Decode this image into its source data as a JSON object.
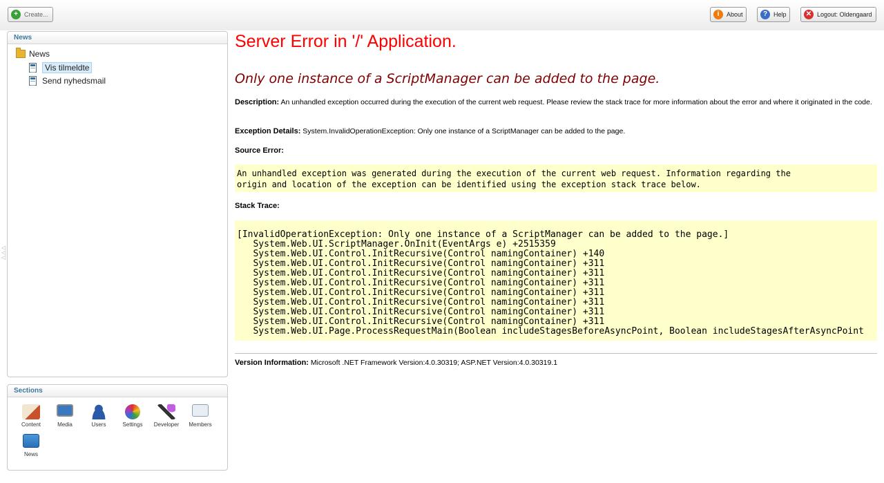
{
  "toolbar": {
    "create_label": "Create...",
    "about_label": "About",
    "help_label": "Help",
    "logout_label": "Logout: Oldengaard"
  },
  "tree_panel": {
    "title": "News",
    "root": "News",
    "items": [
      "Vis tilmeldte",
      "Send nyhedsmail"
    ],
    "selected_index": 0
  },
  "sections_panel": {
    "title": "Sections",
    "items": [
      {
        "label": "Content",
        "icon": "content-icon",
        "color": "#c8502a"
      },
      {
        "label": "Media",
        "icon": "media-icon",
        "color": "#3a78c0"
      },
      {
        "label": "Users",
        "icon": "users-icon",
        "color": "#2a5aa8"
      },
      {
        "label": "Settings",
        "icon": "settings-icon",
        "color": "#e0a020"
      },
      {
        "label": "Developer",
        "icon": "developer-icon",
        "color": "#7a3a9a"
      },
      {
        "label": "Members",
        "icon": "members-icon",
        "color": "#5a7aa0"
      },
      {
        "label": "News",
        "icon": "news-icon",
        "color": "#4a98d8"
      }
    ]
  },
  "error_page": {
    "title": "Server Error in '/' Application.",
    "message": "Only one instance of a ScriptManager can be added to the page.",
    "description_label": "Description:",
    "description_text": "An unhandled exception occurred during the execution of the current web request. Please review the stack trace for more information about the error and where it originated in the code.",
    "exception_label": "Exception Details:",
    "exception_text": "System.InvalidOperationException: Only one instance of a ScriptManager can be added to the page.",
    "source_error_label": "Source Error:",
    "source_error_lines": [
      "An unhandled exception was generated during the execution of the current web request. Information regarding the",
      "origin and location of the exception can be identified using the exception stack trace below."
    ],
    "stack_trace_label": "Stack Trace:",
    "stack_trace_lines": [
      "[InvalidOperationException: Only one instance of a ScriptManager can be added to the page.]",
      "   System.Web.UI.ScriptManager.OnInit(EventArgs e) +2515359",
      "   System.Web.UI.Control.InitRecursive(Control namingContainer) +140",
      "   System.Web.UI.Control.InitRecursive(Control namingContainer) +311",
      "   System.Web.UI.Control.InitRecursive(Control namingContainer) +311",
      "   System.Web.UI.Control.InitRecursive(Control namingContainer) +311",
      "   System.Web.UI.Control.InitRecursive(Control namingContainer) +311",
      "   System.Web.UI.Control.InitRecursive(Control namingContainer) +311",
      "   System.Web.UI.Control.InitRecursive(Control namingContainer) +311",
      "   System.Web.UI.Control.InitRecursive(Control namingContainer) +311",
      "   System.Web.UI.Page.ProcessRequestMain(Boolean includeStagesBeforeAsyncPoint, Boolean includeStagesAfterAsyncPoint"
    ],
    "version_label": "Version Information:",
    "version_text": "Microsoft .NET Framework Version:4.0.30319; ASP.NET Version:4.0.30319.1"
  }
}
